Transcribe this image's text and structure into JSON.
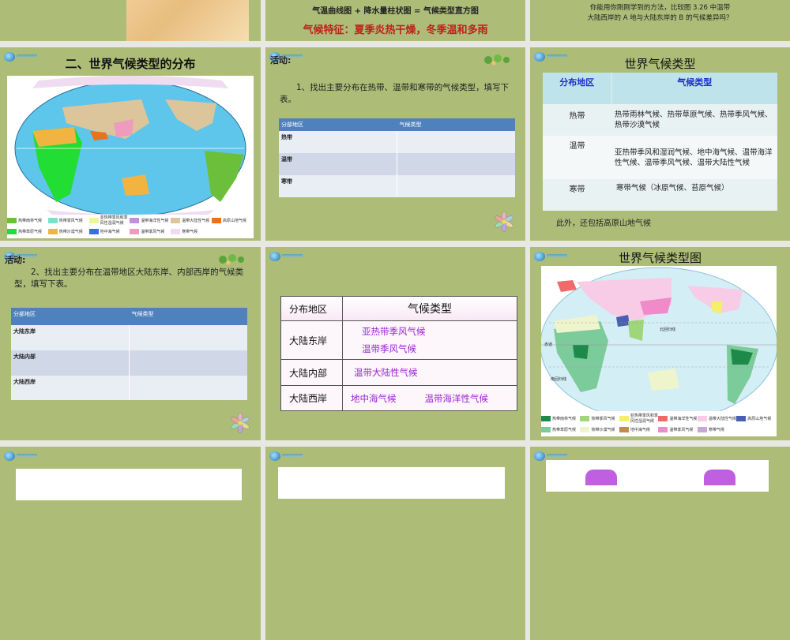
{
  "slides": {
    "s2": {
      "line1": "气温曲线图 + 降水量柱状图 = 气候类型直方图",
      "line2": "气候特征：夏季炎热干燥，冬季温和多雨"
    },
    "s3": {
      "question": "你能用你刚刚学到的方法，比较图 3.26 中温带",
      "question2": "大陆西岸的 A 地与大陆东岸的 B 的气候差异吗？"
    },
    "s4": {
      "title": "二、世界气候类型的分布",
      "legend": [
        {
          "label": "热带雨林气候",
          "color": "#6cbf3a"
        },
        {
          "label": "热带季风气候",
          "color": "#7ee0c8"
        },
        {
          "label": "亚热带季风和季风性湿润气候",
          "color": "#eef5a0"
        },
        {
          "label": "温带海洋性气候",
          "color": "#c48ee0"
        },
        {
          "label": "温带大陆性气候",
          "color": "#dcc59a"
        },
        {
          "label": "高原山地气候",
          "color": "#e8731e"
        },
        {
          "label": "热带草原气候",
          "color": "#22dd33"
        },
        {
          "label": "热带沙漠气候",
          "color": "#f2b440"
        },
        {
          "label": "地中海气候",
          "color": "#3a6ee0"
        },
        {
          "label": "温带季风气候",
          "color": "#ef9bbd"
        },
        {
          "label": "寒带气候",
          "color": "#efdcf0"
        }
      ]
    },
    "s5": {
      "heading": "活动:",
      "text": "1、找出主要分布在热带、温带和寒带的气候类型，填写下表。",
      "headers": [
        "分部地区",
        "气候类型"
      ],
      "rows": [
        "热带",
        "温带",
        "寒带"
      ]
    },
    "s6": {
      "title": "世界气候类型",
      "headers": [
        "分布地区",
        "气候类型"
      ],
      "rows": [
        {
          "zone": "热带",
          "types": "热带雨林气候、热带草原气候、热带季风气候、热带沙漠气候"
        },
        {
          "zone": "温带",
          "types": "亚热带季风和湿润气候、地中海气候、温带海洋性气候、温带季风气候、温带大陆性气候"
        },
        {
          "zone": "寒带",
          "types": "寒带气候（冰原气候、苔原气候）"
        }
      ],
      "note": "此外，还包括高原山地气候"
    },
    "s7": {
      "heading": "活动:",
      "text": "2、找出主要分布在温带地区大陆东岸、内部西岸的气候类型，填写下表。",
      "headers": [
        "分部地区",
        "气候类型"
      ],
      "rows": [
        "大陆东岸",
        "大陆内部",
        "大陆西岸"
      ]
    },
    "s8": {
      "headers": [
        "分布地区",
        "气候类型"
      ],
      "rows": [
        {
          "zone": "大陆东岸",
          "a": "亚热带季风气候",
          "b": "温带季风气候"
        },
        {
          "zone": "大陆内部",
          "a": "温带大陆性气候",
          "b": ""
        },
        {
          "zone": "大陆西岸",
          "a": "地中海气候",
          "b": "温带海洋性气候"
        }
      ]
    },
    "s9": {
      "title": "世界气候类型图",
      "labels": {
        "equator": "赤道",
        "tropic_n": "北回归线",
        "tropic_s": "南回归线"
      },
      "legend": [
        {
          "label": "热带雨林气候",
          "color": "#1e8a4a"
        },
        {
          "label": "热带季风气候",
          "color": "#9fd67a"
        },
        {
          "label": "亚热带季风和季风性湿润气候",
          "color": "#f3ef6a"
        },
        {
          "label": "温带海洋性气候",
          "color": "#f06a6a"
        },
        {
          "label": "温带大陆性气候",
          "color": "#f8cbe6"
        },
        {
          "label": "高原山地气候",
          "color": "#4a5fb0"
        },
        {
          "label": "热带草原气候",
          "color": "#7ccb9a"
        },
        {
          "label": "热带沙漠气候",
          "color": "#eef5cc"
        },
        {
          "label": "地中海气候",
          "color": "#c08a50"
        },
        {
          "label": "温带季风气候",
          "color": "#f08ac8"
        },
        {
          "label": "寒带气候",
          "color": "#c8a8d8"
        }
      ]
    }
  }
}
